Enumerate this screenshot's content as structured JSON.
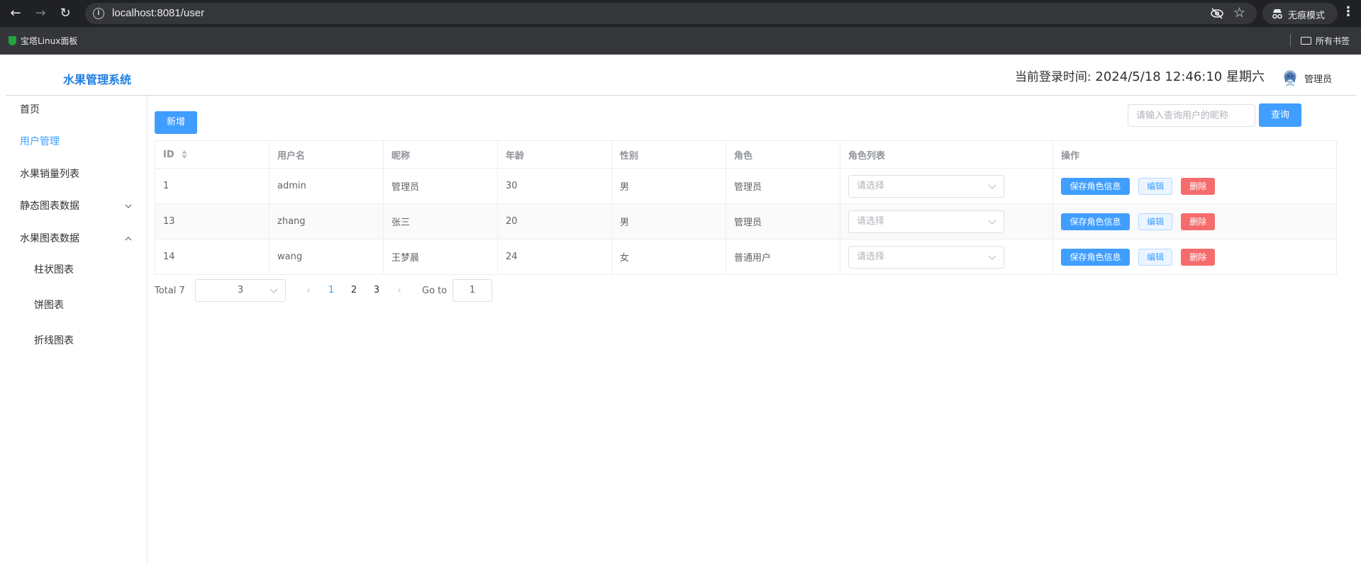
{
  "browser": {
    "url": "localhost:8081/user",
    "incognito_label": "无痕模式",
    "bookmark": "宝塔Linux面板",
    "all_bookmarks": "所有书签"
  },
  "header": {
    "brand": "水果管理系统",
    "login_label": "当前登录时间:",
    "login_time": "2024/5/18 12:46:10 星期六",
    "user_name": "管理员"
  },
  "sidebar": {
    "items": [
      {
        "label": "首页"
      },
      {
        "label": "用户管理"
      },
      {
        "label": "水果销量列表"
      },
      {
        "label": "静态图表数据"
      },
      {
        "label": "水果图表数据"
      },
      {
        "label": "柱状图表"
      },
      {
        "label": "饼图表"
      },
      {
        "label": "折线图表"
      }
    ]
  },
  "toolbar": {
    "add_label": "新增",
    "search_placeholder": "请输入查询用户的昵称",
    "search_label": "查询"
  },
  "table": {
    "columns": [
      "ID",
      "用户名",
      "昵称",
      "年龄",
      "性别",
      "角色",
      "角色列表",
      "操作"
    ],
    "select_placeholder": "请选择",
    "save_label": "保存角色信息",
    "edit_label": "编辑",
    "delete_label": "删除",
    "rows": [
      {
        "id": "1",
        "username": "admin",
        "nickname": "管理员",
        "age": "30",
        "gender": "男",
        "role": "管理员"
      },
      {
        "id": "13",
        "username": "zhang",
        "nickname": "张三",
        "age": "20",
        "gender": "男",
        "role": "管理员"
      },
      {
        "id": "14",
        "username": "wang",
        "nickname": "王梦晨",
        "age": "24",
        "gender": "女",
        "role": "普通用户"
      }
    ]
  },
  "pagination": {
    "total": "Total 7",
    "page_size": "3",
    "pages": [
      "1",
      "2",
      "3"
    ],
    "current_page": "1",
    "goto_label": "Go to",
    "goto_value": "1"
  },
  "colors": {
    "primary": "#409eff",
    "danger": "#f56c6c",
    "brand": "#1f7fe0"
  }
}
